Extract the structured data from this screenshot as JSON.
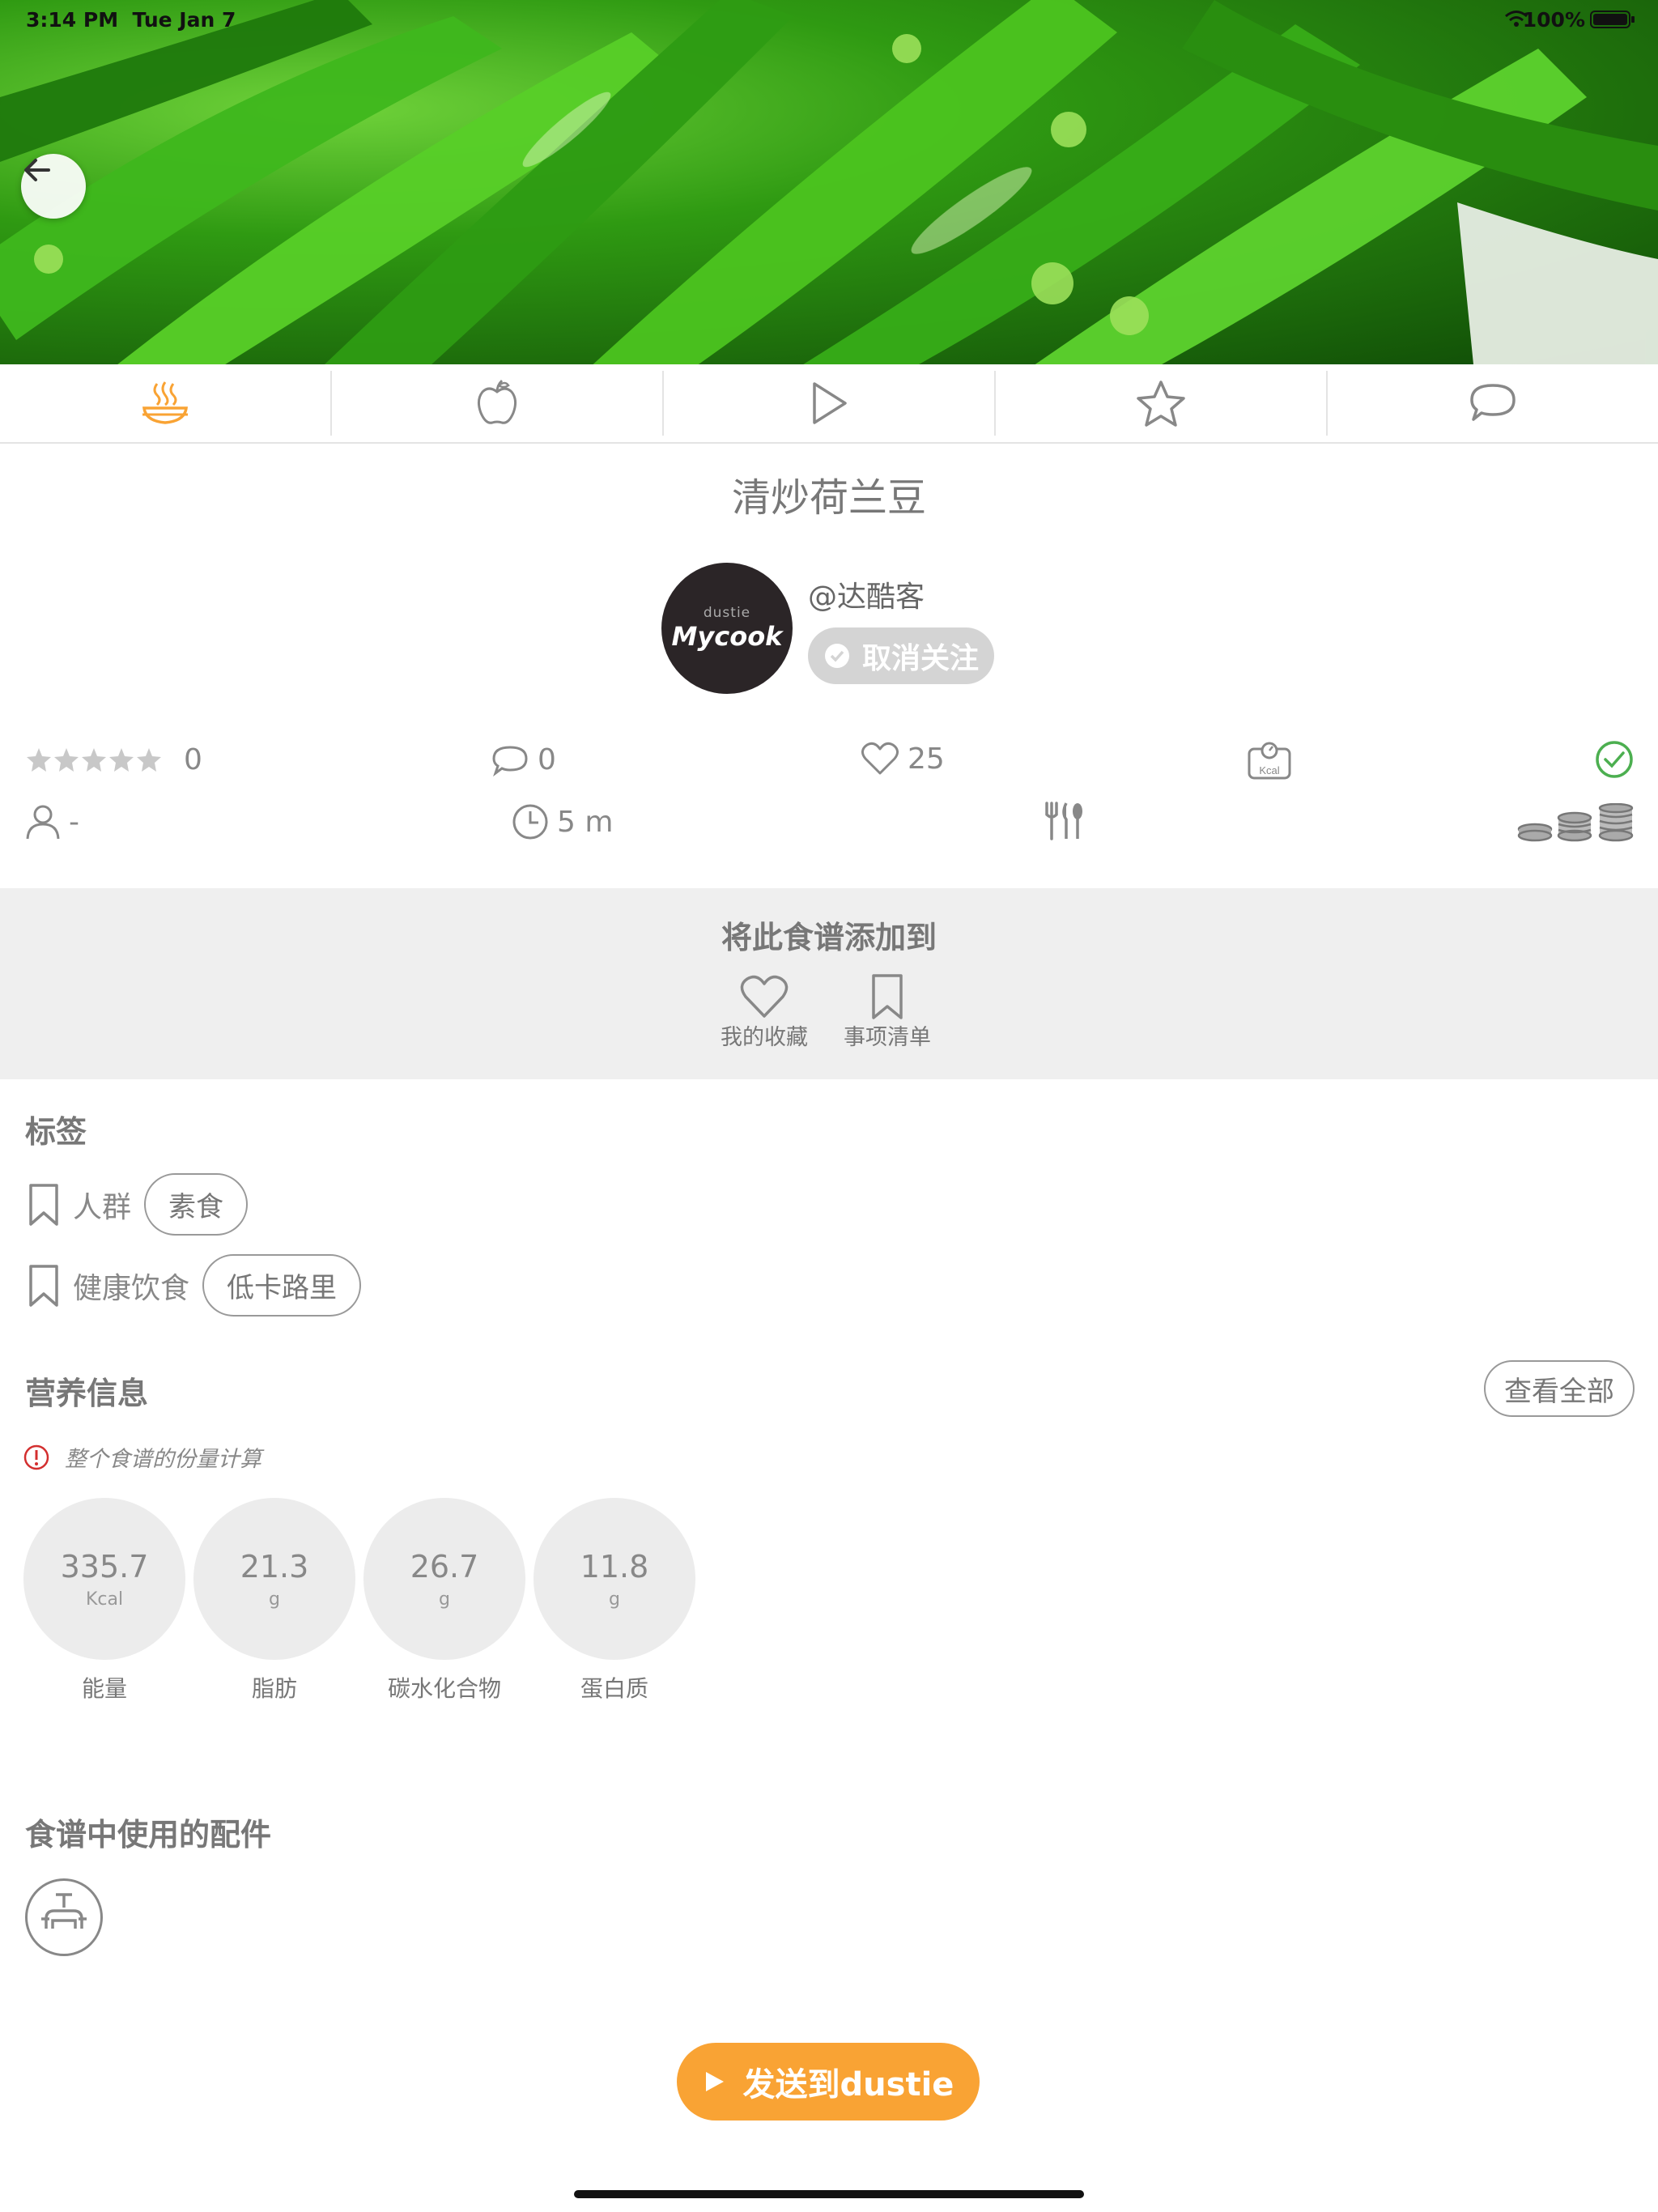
{
  "status_bar": {
    "time": "3:14 PM",
    "date": "Tue Jan 7",
    "battery": "100%"
  },
  "tabs": [
    {
      "name": "recipe",
      "icon": "cooking-pot-icon",
      "active": true
    },
    {
      "name": "ingredients",
      "icon": "apple-icon",
      "active": false
    },
    {
      "name": "video",
      "icon": "play-icon",
      "active": false
    },
    {
      "name": "favorite",
      "icon": "star-icon",
      "active": false
    },
    {
      "name": "comments",
      "icon": "comment-icon",
      "active": false
    }
  ],
  "recipe": {
    "title": "清炒荷兰豆"
  },
  "author": {
    "name": "@达酷客",
    "avatar_small_text": "dustie",
    "avatar_brand_text": "Mycook",
    "unfollow_label": "取消关注"
  },
  "stats": {
    "rating_count": "0",
    "comment_count": "0",
    "like_count": "25",
    "kcal_label": "Kcal",
    "servings": "-",
    "time": "5 m"
  },
  "add_to": {
    "title": "将此食谱添加到",
    "favorites_label": "我的收藏",
    "todo_label": "事项清单"
  },
  "tags": {
    "heading": "标签",
    "rows": [
      {
        "label": "人群",
        "chip": "素食"
      },
      {
        "label": "健康饮食",
        "chip": "低卡路里"
      }
    ]
  },
  "nutrition": {
    "heading": "营养信息",
    "view_all": "查看全部",
    "note": "整个食谱的份量计算",
    "items": [
      {
        "value": "335.7",
        "unit": "Kcal",
        "label": "能量"
      },
      {
        "value": "21.3",
        "unit": "g",
        "label": "脂肪"
      },
      {
        "value": "26.7",
        "unit": "g",
        "label": "碳水化合物"
      },
      {
        "value": "11.8",
        "unit": "g",
        "label": "蛋白质"
      }
    ]
  },
  "accessories": {
    "heading": "食谱中使用的配件"
  },
  "send_button": {
    "label": "发送到dustie"
  },
  "colors": {
    "accent": "#f9a334",
    "check": "#4caf50",
    "alert": "#d32f2f",
    "panel": "#efefef"
  }
}
